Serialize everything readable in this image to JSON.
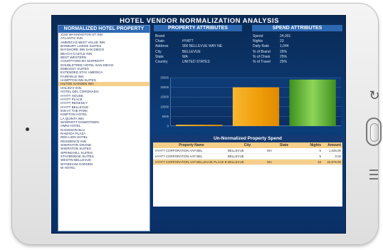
{
  "app": {
    "title": "HOTEL VENDOR NORMALIZATION ANALYSIS"
  },
  "hotel_list": {
    "header": "NORMALIZED HOTEL PROPERTY",
    "selected_index": 13,
    "items": [
      "2160 WASHINGTON ST INN",
      "ATLANTIC INN",
      "AMERICAS BEST VALUE INN",
      "BANBURY LODGE SUITES",
      "BAYSHORE INN SAN DIEGO",
      "BEACH CASTLE INN",
      "BEST WESTERN",
      "COURTYARD BY MARRIOTT",
      "DOUBLETREE HOTEL SAN DIEGO",
      "EMBASSY SUITES",
      "EXTENDED STAY AMERICA",
      "FAIRFIELD INN",
      "HAMPTON INN SUITES",
      "HILTON GARDEN INN",
      "HOLIDAY INN",
      "HOTEL DEL CORONADO",
      "HYATT HOUSE",
      "HYATT PLACE",
      "HYATT REGENCY",
      "HYATT BELLEVUE",
      "INN AT THE PARK",
      "KIMPTON HOTEL",
      "LA QUINTA INN",
      "MARRIOTT DOWNTOWN",
      "OMNI HOTEL",
      "RADISSON BLU",
      "RAMADA PLAZA",
      "RED LION HOTEL",
      "RESIDENCE INN",
      "SHERATON GRAND",
      "SHERATON SUITES",
      "SPRINGHILL SUITES",
      "STAYBRIDGE SUITES",
      "WESTIN BELLEVUE",
      "WYNDHAM GARDEN",
      "W HOTEL"
    ]
  },
  "property": {
    "header": "PROPERTY ATTRIBUTES",
    "fields": [
      {
        "label": "Brand",
        "value": ""
      },
      {
        "label": "Chain",
        "value": "HYATT"
      },
      {
        "label": "Address",
        "value": "900 BELLEVUE WAY NE"
      },
      {
        "label": "City",
        "value": "BELLEVUE"
      },
      {
        "label": "State",
        "value": "WA"
      },
      {
        "label": "Country",
        "value": "UNITED STATES"
      }
    ]
  },
  "spend": {
    "header": "SPEND ATTRIBUTES",
    "fields": [
      {
        "label": "Spend",
        "value": "24,001"
      },
      {
        "label": "Nights",
        "value": "23"
      },
      {
        "label": "Daily Rate",
        "value": "1,044"
      },
      {
        "label": "% of Brand",
        "value": "25%"
      },
      {
        "label": "% of Chain",
        "value": "25%"
      },
      {
        "label": "% of Travel",
        "value": "25%"
      }
    ]
  },
  "chart_data": {
    "type": "bar",
    "categories": [
      "",
      "",
      ""
    ],
    "series": [
      {
        "values": [
          700,
          20000,
          24001
        ]
      }
    ],
    "yticks": [
      "25000",
      "20000",
      "15000",
      "10000",
      "5000",
      "0"
    ],
    "ylim": [
      0,
      25000
    ],
    "colors": [
      "#f2a10c",
      "#f2a10c",
      "#4caf26"
    ]
  },
  "spend_table": {
    "title": "Un-Normalized  Property Spend",
    "columns": [
      "Property Name",
      "City",
      "State",
      "Nights",
      "Amount"
    ],
    "selected_index": 2,
    "rows": [
      {
        "name": "HYATT CORPORATION AAP BEL",
        "city": "BELLEVUE",
        "state": "WA",
        "nights": "5",
        "amount": "1,025.00"
      },
      {
        "name": "HYATT CORPORATION AAP BEL",
        "city": "BELLEVUE",
        "state": "",
        "nights": "5",
        "amount": "0.00"
      },
      {
        "name": "HYATT CORPORATION AAP BELLEVUE PLACE B",
        "city": "BELLEVUE",
        "state": "WA",
        "nights": "18",
        "amount": "22,976.00"
      }
    ]
  }
}
